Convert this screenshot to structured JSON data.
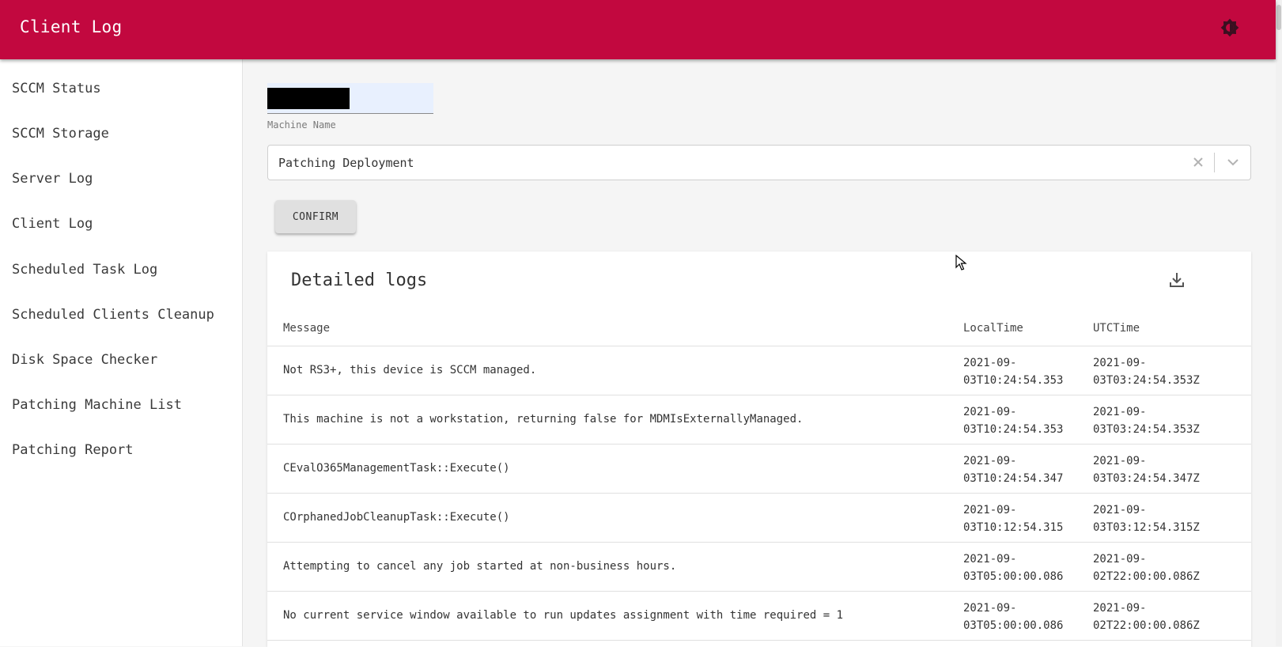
{
  "header": {
    "title": "Client Log",
    "theme_toggle": "brightness-icon"
  },
  "sidebar": {
    "items": [
      {
        "label": "SCCM Status"
      },
      {
        "label": "SCCM Storage"
      },
      {
        "label": "Server Log"
      },
      {
        "label": "Client Log"
      },
      {
        "label": "Scheduled Task Log"
      },
      {
        "label": "Scheduled Clients Cleanup"
      },
      {
        "label": "Disk Space Checker"
      },
      {
        "label": "Patching Machine List"
      },
      {
        "label": "Patching Report"
      }
    ]
  },
  "form": {
    "machine_name_label": "Machine Name",
    "log_type_value": "Patching Deployment",
    "confirm_label": "CONFIRM"
  },
  "logs": {
    "title": "Detailed logs",
    "columns": {
      "message": "Message",
      "local": "LocalTime",
      "utc": "UTCTime"
    },
    "rows": [
      {
        "message": "Not RS3+, this device is SCCM managed.",
        "local": "2021-09-\n03T10:24:54.353",
        "utc": "2021-09-\n03T03:24:54.353Z"
      },
      {
        "message": "This machine is not a workstation, returning false for MDMIsExternallyManaged.",
        "local": "2021-09-\n03T10:24:54.353",
        "utc": "2021-09-\n03T03:24:54.353Z"
      },
      {
        "message": "CEvalO365ManagementTask::Execute()",
        "local": "2021-09-\n03T10:24:54.347",
        "utc": "2021-09-\n03T03:24:54.347Z"
      },
      {
        "message": "COrphanedJobCleanupTask::Execute()",
        "local": "2021-09-\n03T10:12:54.315",
        "utc": "2021-09-\n03T03:12:54.315Z"
      },
      {
        "message": "Attempting to cancel any job started at non-business hours.",
        "local": "2021-09-\n03T05:00:00.086",
        "utc": "2021-09-\n02T22:00:00.086Z"
      },
      {
        "message": "No current service window available to run updates assignment with time required = 1",
        "local": "2021-09-\n03T05:00:00.086",
        "utc": "2021-09-\n02T22:00:00.086Z"
      }
    ]
  }
}
